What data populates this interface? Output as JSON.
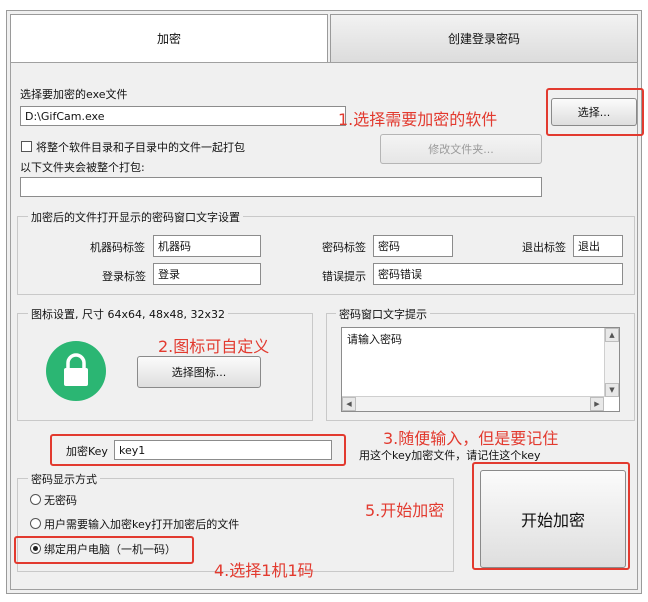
{
  "tabs": [
    {
      "label": "加密",
      "active": true
    },
    {
      "label": "创建登录密码",
      "active": false
    }
  ],
  "file_section": {
    "label": "选择要加密的exe文件",
    "path_value": "D:\\GifCam.exe",
    "select_button": "选择...",
    "pack_checkbox_label": "将整个软件目录和子目录中的文件一起打包",
    "modify_folder_button": "修改文件夹...",
    "pack_folder_label": "以下文件夹会被整个打包:",
    "pack_folder_value": ""
  },
  "window_text_settings": {
    "title": "加密后的文件打开显示的密码窗口文字设置",
    "machine_code_label": "机器码标签",
    "machine_code_value": "机器码",
    "password_label": "密码标签",
    "password_value": "密码",
    "exit_label": "退出标签",
    "exit_value": "退出",
    "login_label": "登录标签",
    "login_value": "登录",
    "error_label": "错误提示",
    "error_value": "密码错误"
  },
  "icon_settings": {
    "title": "图标设置, 尺寸 64x64, 48x48, 32x32",
    "select_icon_button": "选择图标...",
    "lock_color": "#2bb673"
  },
  "password_prompt": {
    "title": "密码窗口文字提示",
    "text": "请输入密码"
  },
  "key_section": {
    "label": "加密Key",
    "value": "key1",
    "hint": "用这个key加密文件，请记住这个key"
  },
  "display_mode": {
    "title": "密码显示方式",
    "options": [
      {
        "label": "无密码",
        "checked": false
      },
      {
        "label": "用户需要输入加密key打开加密后的文件",
        "checked": false
      },
      {
        "label": "绑定用户电脑（一机一码）",
        "checked": true
      }
    ]
  },
  "start_button": "开始加密",
  "annotations": {
    "a1": "1.选择需要加密的软件",
    "a2": "2.图标可自定义",
    "a3": "3.随便输入，但是要记住",
    "a4": "4.选择1机1码",
    "a5": "5.开始加密",
    "color": "#e23a2f"
  }
}
